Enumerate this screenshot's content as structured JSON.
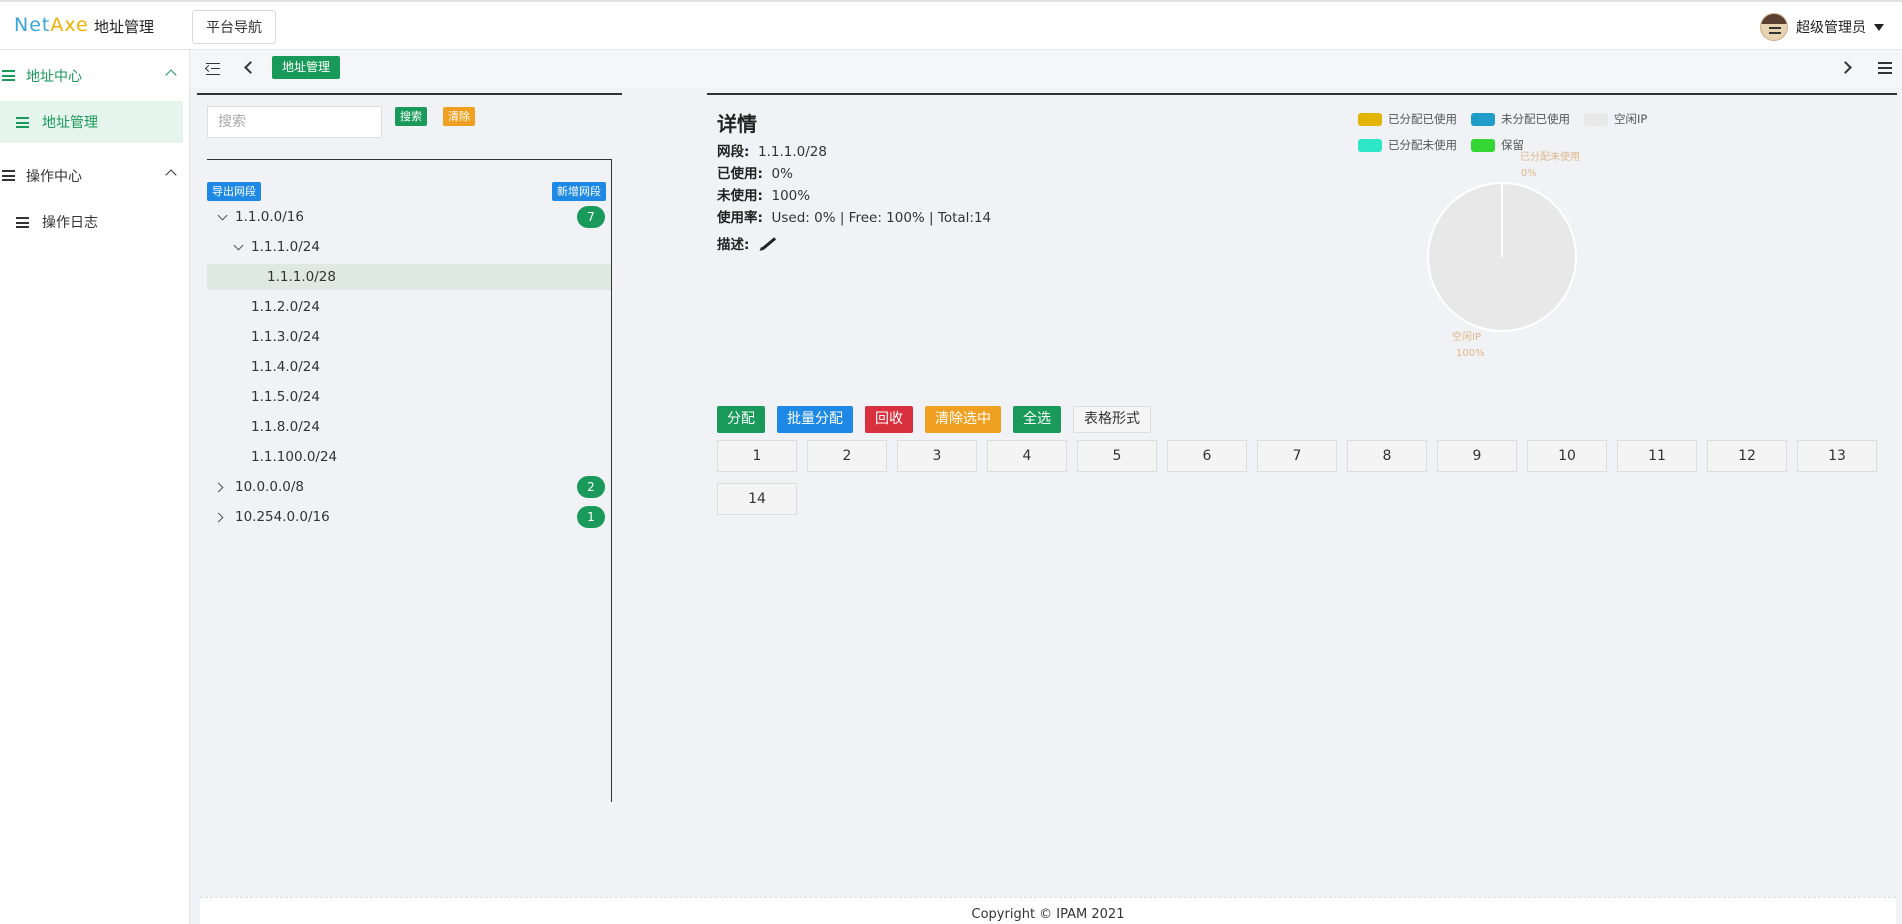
{
  "header": {
    "logo_part1": "Net",
    "logo_part2": "Axe",
    "app_title": "地址管理",
    "nav_button": "平台导航",
    "user_name": "超级管理员"
  },
  "sidebar": {
    "groups": [
      {
        "label": "地址中心",
        "items": [
          {
            "label": "地址管理"
          }
        ]
      },
      {
        "label": "操作中心",
        "items": [
          {
            "label": "操作日志"
          }
        ]
      }
    ]
  },
  "tabs": {
    "active": "地址管理"
  },
  "tree_panel": {
    "search_placeholder": "搜索",
    "search_button": "搜索",
    "clear_button": "清除",
    "export_button": "导出网段",
    "add_button": "新增网段",
    "nodes": [
      {
        "label": "1.1.0.0/16",
        "count": "7"
      },
      {
        "label": "1.1.1.0/24"
      },
      {
        "label": "1.1.1.0/28"
      },
      {
        "label": "1.1.2.0/24"
      },
      {
        "label": "1.1.3.0/24"
      },
      {
        "label": "1.1.4.0/24"
      },
      {
        "label": "1.1.5.0/24"
      },
      {
        "label": "1.1.8.0/24"
      },
      {
        "label": "1.1.100.0/24"
      },
      {
        "label": "10.0.0.0/8",
        "count": "2"
      },
      {
        "label": "10.254.0.0/16",
        "count": "1"
      }
    ]
  },
  "details": {
    "title": "详情",
    "segment_label": "网段:",
    "segment_value": "1.1.1.0/28",
    "used_label": "已使用:",
    "used_value": "0%",
    "unused_label": "未使用:",
    "unused_value": "100%",
    "usage_label": "使用率:",
    "usage_value": "Used: 0% | Free: 100% | Total:14",
    "desc_label": "描述:"
  },
  "legend": [
    {
      "label": "已分配已使用",
      "color": "#e0b400"
    },
    {
      "label": "未分配已使用",
      "color": "#1f9cc7"
    },
    {
      "label": "空闲IP",
      "color": "#e8e8e8"
    },
    {
      "label": "已分配未使用",
      "color": "#2ee6c8"
    },
    {
      "label": "保留",
      "color": "#33d633"
    }
  ],
  "chart_data": {
    "type": "pie",
    "slices": [
      {
        "name": "已分配未使用",
        "value": 0,
        "label": "0%"
      },
      {
        "name": "空闲IP",
        "value": 100,
        "label": "100%"
      }
    ]
  },
  "actions": {
    "allocate": "分配",
    "batch_allocate": "批量分配",
    "reclaim": "回收",
    "clear_selection": "清除选中",
    "select_all": "全选",
    "table_view": "表格形式"
  },
  "ip_cells": [
    "1",
    "2",
    "3",
    "4",
    "5",
    "6",
    "7",
    "8",
    "9",
    "10",
    "11",
    "12",
    "13",
    "14"
  ],
  "footer": {
    "copyright": "Copyright © IPAM 2021"
  }
}
